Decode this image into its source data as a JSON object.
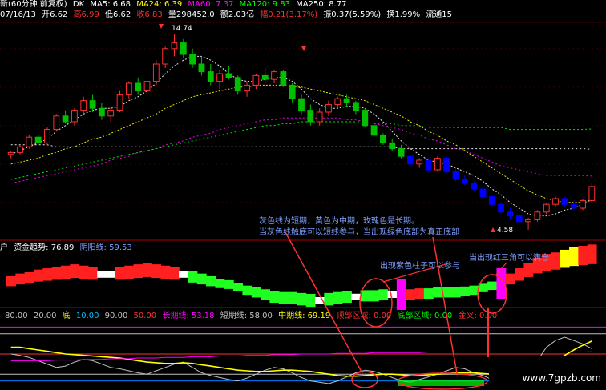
{
  "header": {
    "title": "新(60分钟 前复权)",
    "dk": "DK",
    "ma5": "MA5: 6.68",
    "ma24": "MA24: 6.39",
    "ma60": "MA60: 7.37",
    "ma120": "MA120: 9.83",
    "ma250": "MA250: 8.77",
    "date": "07/16/13",
    "open": "开6.62",
    "high": "高6.99",
    "low": "低6.62",
    "close": "收6.83",
    "volume": "量298452.0",
    "amount": "额2.03亿",
    "change": "幅0.21(3.17%)",
    "swing": "振0.37(5.59%)",
    "turnover": "换1.99%",
    "float": "流通15"
  },
  "colors": {
    "up": "#ff3030",
    "down_main": "#00c000",
    "down_late": "#0000ff",
    "ma5": "#ffffff",
    "ma24": "#ffff00",
    "ma60": "#ff00ff",
    "ma120": "#00ff00",
    "ma250": "#ffffff",
    "note": "#7f9fff",
    "highlight": "#ff3030"
  },
  "annotations": {
    "note_gray": "灰色线为短期，黄色为中期，玫瑰色是长期。",
    "note_touch": "当灰色线触底可以短线参与，当出现绿色底部为真正底部",
    "note_purple": "出现紫色柱子可以参与",
    "note_triangle": "当出现红三角可以满仓",
    "high_label": "14.74",
    "low_label": "4.58"
  },
  "panel2": {
    "label_prefix": "户",
    "fund_trend": "资金趋势: 76.89",
    "yin_yang": "阴阳线: 59.53"
  },
  "panel3": {
    "lvl80": "80.00",
    "lvl20": "20.00",
    "di": "底",
    "lvl10": "10.00",
    "lvl90": "90.00",
    "lvl50": "50.00",
    "long": "长期线: 53.18",
    "short": "短期线: 58.00",
    "mid": "中期线: 69.19",
    "top_zone": "顶部区域: 0.00",
    "bottom_zone": "底部区域: 0.00",
    "golden_cross": "金叉: 0.00"
  },
  "watermark": "www.7gpzb.com",
  "chart_data": [
    {
      "type": "candlestick",
      "title": "60分钟 前复权",
      "ohlc": [
        [
          8.5,
          8.7,
          8.3,
          8.6
        ],
        [
          8.6,
          9.0,
          8.5,
          8.9
        ],
        [
          8.9,
          9.5,
          8.8,
          9.4
        ],
        [
          9.4,
          9.6,
          9.0,
          9.1
        ],
        [
          9.1,
          9.9,
          9.0,
          9.8
        ],
        [
          9.8,
          10.6,
          9.7,
          10.5
        ],
        [
          10.5,
          10.8,
          10.1,
          10.2
        ],
        [
          10.2,
          10.9,
          10.0,
          10.8
        ],
        [
          10.8,
          11.5,
          10.6,
          11.3
        ],
        [
          11.3,
          11.6,
          10.7,
          10.9
        ],
        [
          10.9,
          11.2,
          10.3,
          10.5
        ],
        [
          10.5,
          11.0,
          10.2,
          10.8
        ],
        [
          10.8,
          11.8,
          10.7,
          11.6
        ],
        [
          11.6,
          12.3,
          11.4,
          12.2
        ],
        [
          12.2,
          12.5,
          11.6,
          11.8
        ],
        [
          11.8,
          12.4,
          11.5,
          12.3
        ],
        [
          12.3,
          13.4,
          12.1,
          13.2
        ],
        [
          13.2,
          14.1,
          13.0,
          14.0
        ],
        [
          14.0,
          14.74,
          13.6,
          14.3
        ],
        [
          14.3,
          14.5,
          13.5,
          13.7
        ],
        [
          13.7,
          14.0,
          13.0,
          13.2
        ],
        [
          13.2,
          13.6,
          12.6,
          12.8
        ],
        [
          12.8,
          13.2,
          12.1,
          12.3
        ],
        [
          12.3,
          12.9,
          11.9,
          12.7
        ],
        [
          12.7,
          13.1,
          12.4,
          12.5
        ],
        [
          12.5,
          12.6,
          11.6,
          11.8
        ],
        [
          11.8,
          12.3,
          11.5,
          12.1
        ],
        [
          12.1,
          12.7,
          11.9,
          12.6
        ],
        [
          12.6,
          13.0,
          12.2,
          12.4
        ],
        [
          12.4,
          12.9,
          12.2,
          12.8
        ],
        [
          12.8,
          12.9,
          12.0,
          12.1
        ],
        [
          12.1,
          12.2,
          11.2,
          11.4
        ],
        [
          11.4,
          11.6,
          10.6,
          10.8
        ],
        [
          10.8,
          11.1,
          10.0,
          10.2
        ],
        [
          10.2,
          10.9,
          10.0,
          10.7
        ],
        [
          10.7,
          11.3,
          10.5,
          11.1
        ],
        [
          11.1,
          11.5,
          10.9,
          11.4
        ],
        [
          11.4,
          11.6,
          11.0,
          11.2
        ],
        [
          11.2,
          11.3,
          10.6,
          10.8
        ],
        [
          10.8,
          10.9,
          9.9,
          10.0
        ],
        [
          10.0,
          10.1,
          9.4,
          9.5
        ],
        [
          9.5,
          9.6,
          9.0,
          9.1
        ],
        [
          9.1,
          9.3,
          8.7,
          8.8
        ],
        [
          8.8,
          9.0,
          8.3,
          8.4
        ],
        [
          8.4,
          8.5,
          7.9,
          8.0
        ],
        [
          8.0,
          8.3,
          7.8,
          8.2
        ],
        [
          8.2,
          8.3,
          7.6,
          7.7
        ],
        [
          7.7,
          8.4,
          7.6,
          8.3
        ],
        [
          8.3,
          8.4,
          7.5,
          7.6
        ],
        [
          7.6,
          7.8,
          7.1,
          7.2
        ],
        [
          7.2,
          7.4,
          6.9,
          7.0
        ],
        [
          7.0,
          7.1,
          6.6,
          6.7
        ],
        [
          6.7,
          6.9,
          6.2,
          6.3
        ],
        [
          6.3,
          6.4,
          5.8,
          5.9
        ],
        [
          5.9,
          6.0,
          5.4,
          5.5
        ],
        [
          5.5,
          5.7,
          5.1,
          5.3
        ],
        [
          5.3,
          5.4,
          4.9,
          5.0
        ],
        [
          5.0,
          5.2,
          4.58,
          5.1
        ],
        [
          5.1,
          5.6,
          5.0,
          5.5
        ],
        [
          5.5,
          6.0,
          5.4,
          5.9
        ],
        [
          5.9,
          6.3,
          5.8,
          6.2
        ],
        [
          6.2,
          6.3,
          5.8,
          5.9
        ],
        [
          5.9,
          6.1,
          5.6,
          5.7
        ],
        [
          5.7,
          6.2,
          5.6,
          6.1
        ],
        [
          6.1,
          6.99,
          6.0,
          6.83
        ]
      ],
      "ma5": [
        8.5,
        8.7,
        8.9,
        9.1,
        9.3,
        9.7,
        10.0,
        10.3,
        10.6,
        10.8,
        10.9,
        10.9,
        11.0,
        11.3,
        11.5,
        11.8,
        12.2,
        12.7,
        13.1,
        13.4,
        13.6,
        13.6,
        13.4,
        13.1,
        12.7,
        12.4,
        12.3,
        12.3,
        12.4,
        12.5,
        12.5,
        12.3,
        11.9,
        11.4,
        11.1,
        10.9,
        10.9,
        11.0,
        11.0,
        10.9,
        10.6,
        10.2,
        9.7,
        9.2,
        8.8,
        8.5,
        8.2,
        8.1,
        8.0,
        7.8,
        7.6,
        7.4,
        7.1,
        6.7,
        6.4,
        6.0,
        5.7,
        5.4,
        5.3,
        5.3,
        5.4,
        5.6,
        5.7,
        5.9,
        6.2
      ],
      "ma24": [
        8.0,
        8.1,
        8.2,
        8.3,
        8.5,
        8.6,
        8.8,
        8.9,
        9.1,
        9.3,
        9.4,
        9.6,
        9.8,
        10.0,
        10.2,
        10.4,
        10.6,
        10.9,
        11.1,
        11.3,
        11.5,
        11.6,
        11.7,
        11.8,
        11.9,
        12.0,
        12.0,
        12.1,
        12.1,
        12.1,
        12.1,
        12.0,
        12.0,
        11.9,
        11.8,
        11.7,
        11.6,
        11.5,
        11.4,
        11.3,
        11.1,
        10.9,
        10.7,
        10.5,
        10.2,
        10.0,
        9.7,
        9.5,
        9.2,
        9.0,
        8.7,
        8.4,
        8.1,
        7.8,
        7.5,
        7.2,
        6.9,
        6.6,
        6.4,
        6.2,
        6.1,
        6.0,
        6.0,
        6.0,
        6.1
      ],
      "ma60": [
        7.0,
        7.1,
        7.2,
        7.3,
        7.4,
        7.5,
        7.6,
        7.7,
        7.8,
        7.9,
        8.0,
        8.2,
        8.3,
        8.4,
        8.6,
        8.7,
        8.8,
        9.0,
        9.1,
        9.2,
        9.4,
        9.5,
        9.6,
        9.8,
        9.9,
        10.0,
        10.1,
        10.2,
        10.3,
        10.3,
        10.4,
        10.4,
        10.4,
        10.4,
        10.4,
        10.4,
        10.4,
        10.3,
        10.3,
        10.2,
        10.1,
        10.0,
        9.9,
        9.8,
        9.6,
        9.5,
        9.3,
        9.2,
        9.0,
        8.8,
        8.7,
        8.5,
        8.3,
        8.1,
        7.9,
        7.8,
        7.7,
        7.6,
        7.5,
        7.4,
        7.4,
        7.4,
        7.4,
        7.4,
        7.37
      ],
      "ma120": [
        7.2,
        7.3,
        7.4,
        7.5,
        7.6,
        7.7,
        7.8,
        7.9,
        8.0,
        8.1,
        8.2,
        8.3,
        8.4,
        8.5,
        8.6,
        8.7,
        8.8,
        8.9,
        9.0,
        9.1,
        9.2,
        9.3,
        9.4,
        9.5,
        9.6,
        9.7,
        9.8,
        9.9,
        10.0,
        10.0,
        10.1,
        10.1,
        10.2,
        10.2,
        10.2,
        10.2,
        10.2,
        10.2,
        10.2,
        10.2,
        10.1,
        10.1,
        10.1,
        10.0,
        10.0,
        10.0,
        9.9,
        9.9,
        9.9,
        9.9,
        9.9,
        9.9,
        9.9,
        9.9,
        9.9,
        9.8,
        9.8,
        9.8,
        9.8,
        9.8,
        9.8,
        9.8,
        9.8,
        9.8,
        9.83
      ],
      "ma250": [
        9.0,
        9.0,
        9.0,
        9.0,
        9.0,
        8.9,
        8.9,
        8.9,
        8.9,
        8.9,
        8.9,
        8.9,
        8.9,
        8.9,
        8.9,
        8.9,
        8.9,
        8.9,
        8.9,
        8.9,
        8.9,
        8.9,
        8.9,
        8.9,
        8.9,
        8.9,
        8.9,
        8.9,
        8.9,
        8.9,
        8.9,
        8.9,
        8.9,
        8.9,
        8.9,
        8.9,
        8.9,
        8.9,
        8.9,
        8.9,
        8.9,
        8.9,
        8.9,
        8.8,
        8.8,
        8.8,
        8.8,
        8.8,
        8.8,
        8.8,
        8.8,
        8.8,
        8.8,
        8.8,
        8.8,
        8.8,
        8.8,
        8.8,
        8.8,
        8.8,
        8.8,
        8.8,
        8.8,
        8.8,
        8.77
      ]
    },
    {
      "type": "area",
      "title": "资金趋势 / 阴阳线",
      "values": [
        60,
        62,
        63,
        65,
        66,
        67,
        68,
        69,
        68,
        67,
        66,
        66,
        67,
        68,
        69,
        70,
        69,
        68,
        67,
        66,
        64,
        62,
        60,
        58,
        57,
        55,
        52,
        50,
        48,
        46,
        45,
        45,
        44,
        43,
        43,
        44,
        45,
        46,
        46,
        47,
        47,
        48,
        48,
        48,
        48,
        49,
        49,
        50,
        50,
        50,
        51,
        52,
        54,
        56,
        58,
        62,
        66,
        70,
        74,
        76.89,
        78,
        80,
        82,
        83,
        84
      ],
      "phase": [
        "up",
        "up",
        "up",
        "up",
        "up",
        "up",
        "up",
        "up",
        "up",
        "up",
        "flat",
        "flat",
        "up",
        "up",
        "up",
        "up",
        "up",
        "up",
        "up",
        "flat",
        "down",
        "down",
        "down",
        "down",
        "down",
        "down",
        "down",
        "down",
        "down",
        "down",
        "down",
        "down",
        "down",
        "down",
        "flat",
        "down",
        "down",
        "down",
        "flat",
        "down",
        "down",
        "down",
        "flat",
        "purple",
        "up",
        "up",
        "down",
        "down",
        "down",
        "down",
        "down",
        "down",
        "down",
        "down",
        "purple",
        "up",
        "up",
        "up",
        "up",
        "up",
        "up",
        "yellow",
        "yellow",
        "up",
        "up"
      ]
    },
    {
      "type": "line",
      "title": "长期线 / 短期线 / 中期线",
      "series": [
        {
          "name": "短期线",
          "values": [
            50,
            48,
            45,
            40,
            35,
            30,
            32,
            38,
            42,
            40,
            35,
            30,
            28,
            25,
            22,
            20,
            25,
            30,
            35,
            38,
            30,
            22,
            18,
            15,
            12,
            10,
            14,
            20,
            26,
            30,
            28,
            22,
            15,
            10,
            8,
            6,
            10,
            16,
            22,
            26,
            24,
            20,
            15,
            10,
            8,
            12,
            16,
            20,
            25,
            30,
            28,
            22,
            18,
            12,
            8,
            6,
            10,
            20,
            40,
            60,
            70,
            75,
            70,
            65,
            58
          ]
        },
        {
          "name": "中期线",
          "values": [
            60,
            60,
            58,
            56,
            54,
            52,
            50,
            49,
            48,
            47,
            46,
            45,
            44,
            42,
            40,
            38,
            37,
            36,
            36,
            37,
            36,
            34,
            32,
            30,
            28,
            26,
            25,
            24,
            24,
            25,
            26,
            26,
            25,
            24,
            22,
            20,
            18,
            17,
            17,
            18,
            19,
            20,
            20,
            19,
            18,
            18,
            19,
            20,
            21,
            22,
            22,
            22,
            21,
            20,
            19,
            18,
            18,
            20,
            25,
            32,
            40,
            48,
            56,
            63,
            69.19
          ]
        },
        {
          "name": "长期线",
          "values": [
            40,
            40,
            40,
            40,
            40,
            41,
            41,
            41,
            42,
            42,
            42,
            43,
            43,
            43,
            44,
            44,
            44,
            45,
            45,
            45,
            46,
            46,
            46,
            47,
            47,
            47,
            48,
            48,
            48,
            49,
            49,
            49,
            50,
            50,
            50,
            50,
            51,
            51,
            51,
            51,
            52,
            52,
            52,
            52,
            52,
            52,
            53,
            53,
            53,
            53,
            53,
            53,
            53,
            53,
            53,
            53,
            53,
            53,
            53,
            53,
            53,
            53,
            53,
            53,
            53.18
          ]
        }
      ],
      "levels": [
        10,
        20,
        50,
        80,
        90
      ]
    }
  ]
}
